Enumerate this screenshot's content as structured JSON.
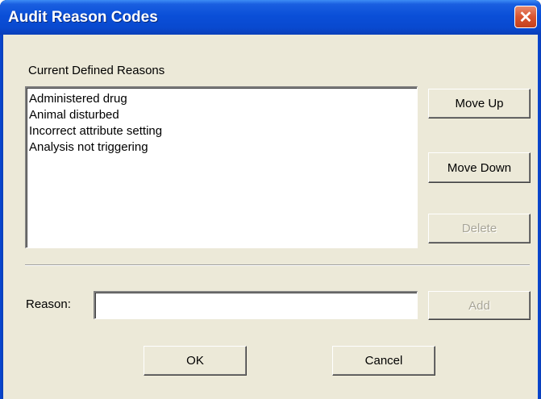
{
  "window": {
    "title": "Audit Reason Codes",
    "close_glyph": "✕"
  },
  "reasons_list": {
    "label": "Current Defined Reasons",
    "items": [
      "Administered drug",
      "Animal disturbed",
      "Incorrect attribute setting",
      "Analysis not triggering"
    ]
  },
  "side_buttons": {
    "move_up": "Move Up",
    "move_down": "Move Down",
    "delete": "Delete"
  },
  "reason_field": {
    "label": "Reason:",
    "value": "",
    "add": "Add"
  },
  "footer": {
    "ok": "OK",
    "cancel": "Cancel"
  },
  "colors": {
    "titlebar": "#0a4fd8",
    "dialog_bg": "#ece9d8",
    "close_button": "#d9542f",
    "disabled_text": "#a8a597"
  },
  "icons": {
    "close": "close-icon"
  }
}
